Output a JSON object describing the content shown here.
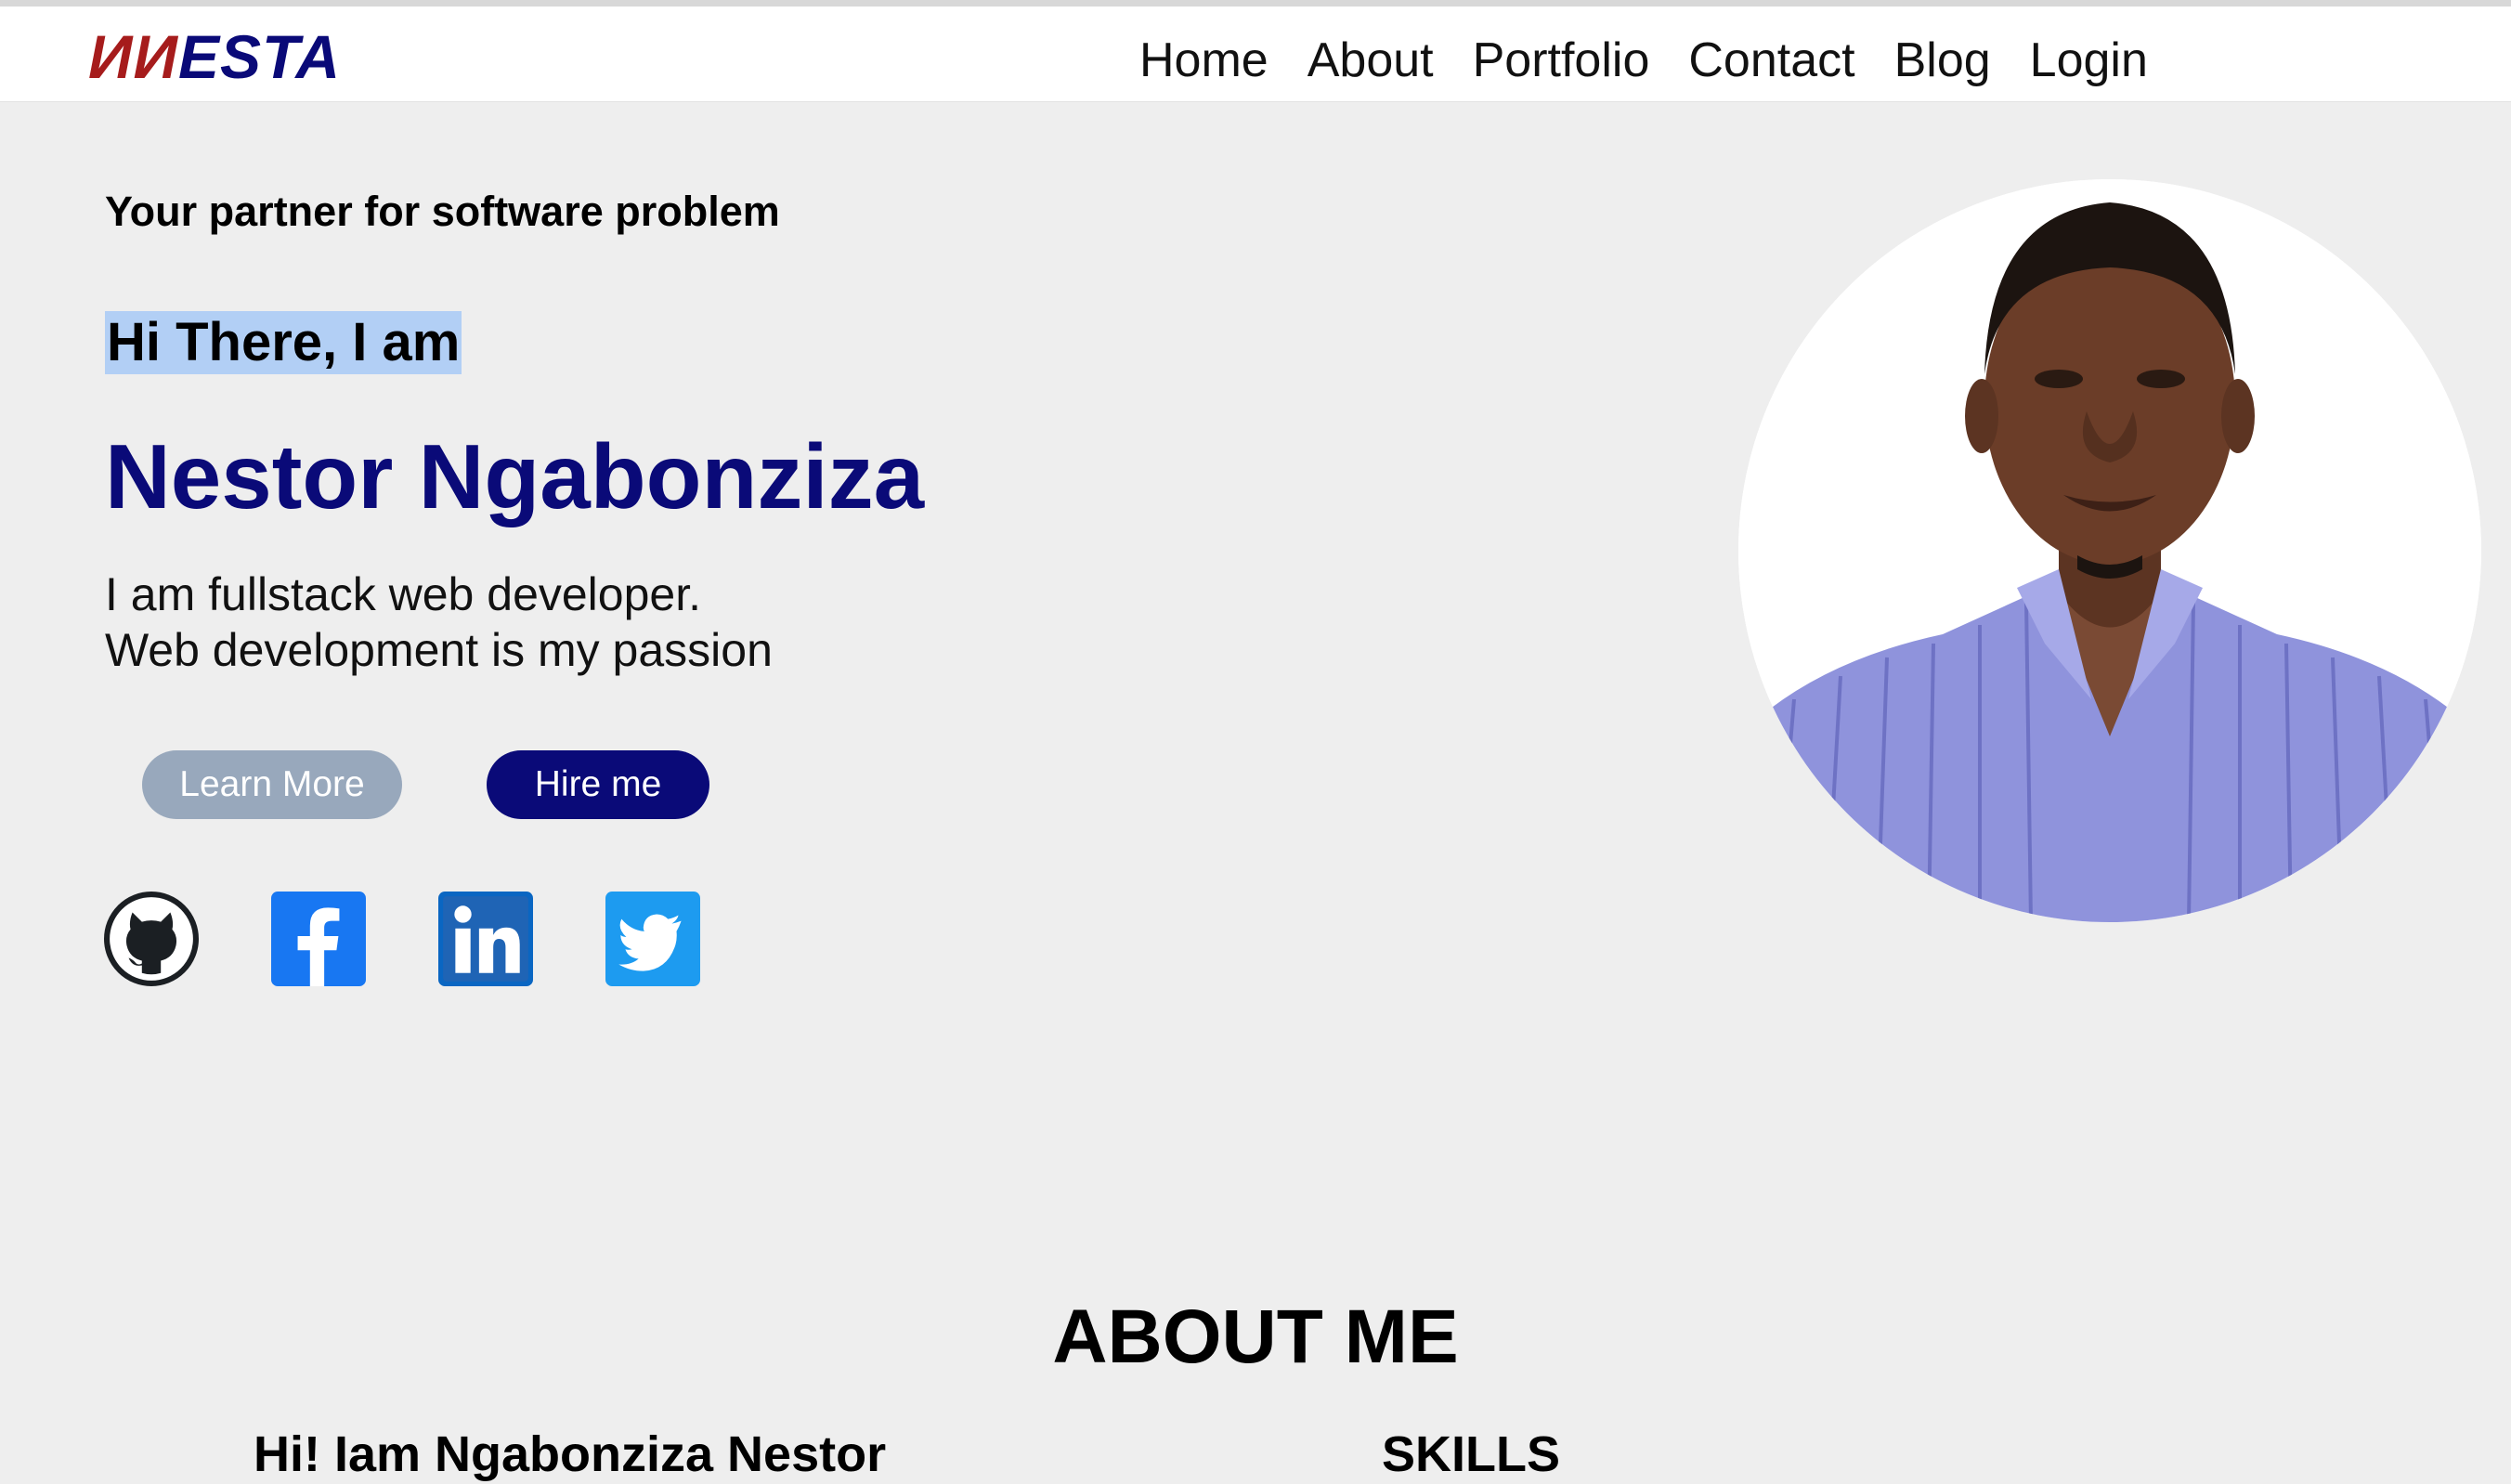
{
  "header": {
    "logo": {
      "part1": "ИИ",
      "part2": "ESTA"
    },
    "nav": [
      "Home",
      "About",
      "Portfolio",
      "Contact",
      "Blog",
      "Login"
    ]
  },
  "hero": {
    "tagline": "Your partner for software problem",
    "greeting": "Hi There, I am",
    "name": "Nestor Ngabonziza",
    "description": [
      "I am fullstack web developer.",
      "Web development is my passion"
    ],
    "buttons": {
      "learn_more": "Learn More",
      "hire_me": "Hire me"
    },
    "social": [
      "github-icon",
      "facebook-icon",
      "linkedin-icon",
      "twitter-icon"
    ]
  },
  "about": {
    "title": "ABOUT ME",
    "intro_heading": "Hi! Iam Ngabonziza Nestor",
    "skills_heading": "SKILLS"
  },
  "colors": {
    "brand_navy": "#0a0a78",
    "brand_red": "#a61c1c",
    "learn_more_bg": "#98a8bc",
    "page_bg": "#eeeeee",
    "selection": "#b2cff5"
  }
}
